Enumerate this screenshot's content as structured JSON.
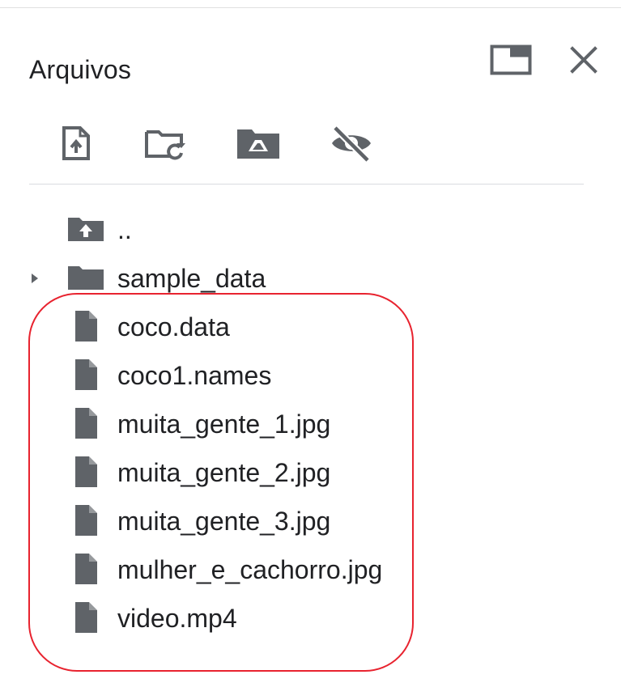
{
  "panel": {
    "title": "Arquivos"
  },
  "header": {
    "buttons": [
      {
        "name": "toggle-window",
        "icon": "window-icon"
      },
      {
        "name": "close",
        "icon": "close-icon"
      }
    ]
  },
  "toolbar": {
    "buttons": [
      {
        "name": "upload",
        "icon": "upload-file-icon"
      },
      {
        "name": "refresh",
        "icon": "folder-refresh-icon"
      },
      {
        "name": "mount-drive",
        "icon": "drive-folder-icon"
      },
      {
        "name": "toggle-hidden",
        "icon": "eye-off-icon"
      }
    ]
  },
  "tree": {
    "parent": {
      "label": "..",
      "icon": "folder-up-icon"
    },
    "folders": [
      {
        "label": "sample_data",
        "icon": "folder-icon",
        "expanded": false
      }
    ],
    "files": [
      {
        "label": "coco.data",
        "icon": "file-icon"
      },
      {
        "label": "coco1.names",
        "icon": "file-icon"
      },
      {
        "label": "muita_gente_1.jpg",
        "icon": "file-icon"
      },
      {
        "label": "muita_gente_2.jpg",
        "icon": "file-icon"
      },
      {
        "label": "muita_gente_3.jpg",
        "icon": "file-icon"
      },
      {
        "label": "mulher_e_cachorro.jpg",
        "icon": "file-icon"
      },
      {
        "label": "video.mp4",
        "icon": "file-icon"
      }
    ]
  },
  "colors": {
    "icon": "#5f6368",
    "text": "#202124",
    "highlight": "#e8232f",
    "divider": "#dadce0"
  }
}
